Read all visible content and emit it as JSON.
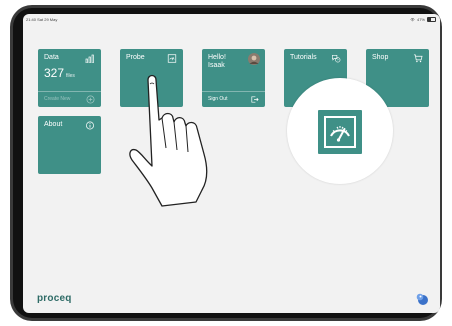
{
  "status_bar": {
    "left_text": "21:40   Sat 29 May",
    "battery_text": "47%"
  },
  "tiles": {
    "data": {
      "title": "Data",
      "count": "327",
      "unit": "files",
      "footer_label": "Create New"
    },
    "probe": {
      "title": "Probe"
    },
    "hello": {
      "title_line1": "Hello!",
      "title_line2": "Isaak",
      "footer_label": "Sign Out"
    },
    "tutorials": {
      "title": "Tutorials"
    },
    "shop": {
      "title": "Shop"
    },
    "about": {
      "title": "About"
    }
  },
  "brand": {
    "logo_text": "proceq"
  },
  "colors": {
    "tile": "#3f9087",
    "screen_bg": "#f2f2f2",
    "logo": "#2e6b66"
  }
}
